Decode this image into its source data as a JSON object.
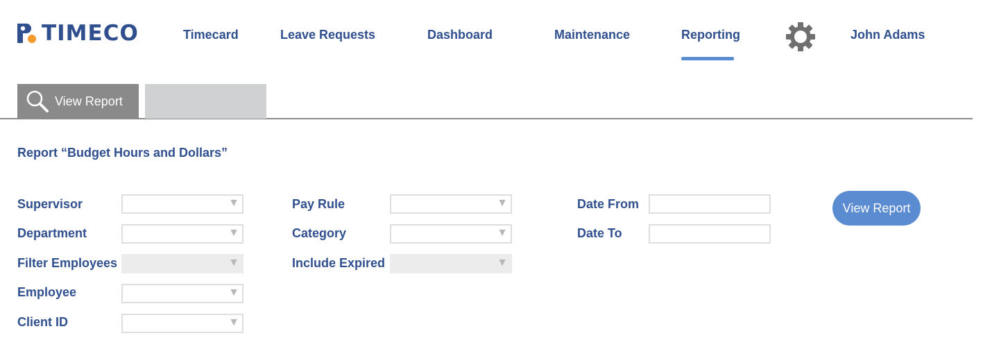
{
  "brand": {
    "name": "TIMECO",
    "primary_color": "#2f4f8f",
    "accent_orange": "#f29a2e",
    "accent_blue": "#5b8bd0"
  },
  "nav": {
    "items": [
      {
        "label": "Timecard"
      },
      {
        "label": "Leave Requests"
      },
      {
        "label": "Dashboard"
      },
      {
        "label": "Maintenance"
      },
      {
        "label": "Reporting",
        "active": true
      }
    ],
    "settings_icon": "gear-icon",
    "user_name": "John Adams"
  },
  "tabs": {
    "active": {
      "label": "View Report",
      "icon": "search-icon"
    },
    "second": {
      "label": ""
    }
  },
  "report": {
    "title": "Report “Budget Hours and Dollars”"
  },
  "filters": {
    "supervisor": {
      "label": "Supervisor",
      "value": ""
    },
    "department": {
      "label": "Department",
      "value": ""
    },
    "filter_employees": {
      "label": "Filter Employees",
      "value": "",
      "disabled": true
    },
    "employee": {
      "label": "Employee",
      "value": ""
    },
    "client_id": {
      "label": "Client ID",
      "value": ""
    },
    "pay_rule": {
      "label": "Pay Rule",
      "value": ""
    },
    "category": {
      "label": "Category",
      "value": ""
    },
    "include_expired": {
      "label": "Include Expired",
      "value": "",
      "disabled": true
    },
    "date_from": {
      "label": "Date From",
      "value": "",
      "placeholder": ""
    },
    "date_to": {
      "label": "Date To",
      "value": "",
      "placeholder": ""
    }
  },
  "dropdown_arrow": "▼",
  "actions": {
    "view_report_label": "View Report"
  }
}
